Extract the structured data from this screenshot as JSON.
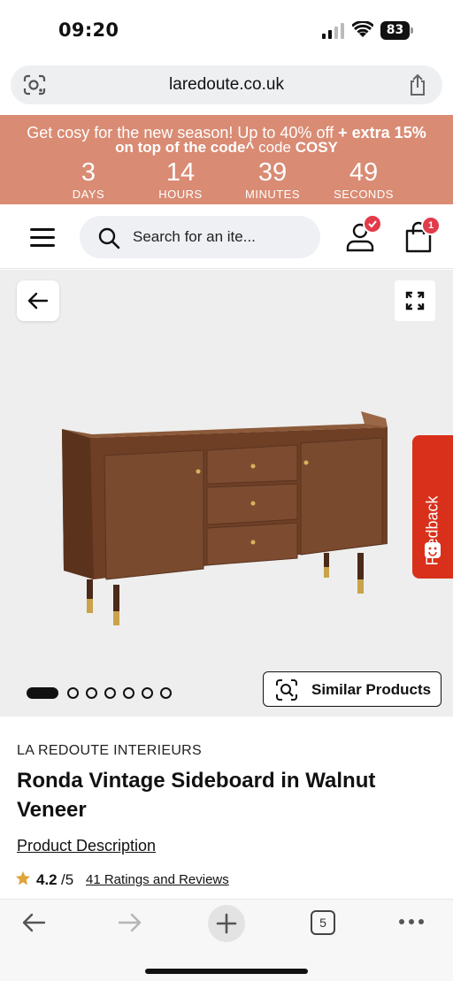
{
  "status_bar": {
    "time": "09:20",
    "battery": "83"
  },
  "browser": {
    "url": "laredoute.co.uk"
  },
  "promo": {
    "line1_start": "Get cosy for the new season! Up to 40% off ",
    "line1_bold": "+ extra 15%",
    "line2_bold": "on top of the code^",
    "line2_mid": " code ",
    "line2_code": "COSY",
    "countdown": [
      {
        "value": "3",
        "label": "DAYS"
      },
      {
        "value": "14",
        "label": "HOURS"
      },
      {
        "value": "39",
        "label": "MINUTES"
      },
      {
        "value": "49",
        "label": "SECONDS"
      }
    ]
  },
  "header": {
    "search_placeholder": "Search for an ite...",
    "cart_count": "1"
  },
  "gallery": {
    "feedback_label": "Feedback",
    "similar_label": "Similar Products",
    "image_count": 7,
    "active_index": 0
  },
  "product": {
    "brand": "LA REDOUTE INTERIEURS",
    "title": "Ronda Vintage Sideboard in Walnut Veneer",
    "description_link": "Product Description",
    "rating": "4.2",
    "rating_max": "/5",
    "reviews_link": "41 Ratings and Reviews"
  },
  "toolbar": {
    "tab_count": "5"
  },
  "colors": {
    "promo_bg": "#d98b73",
    "badge": "#e23b4a",
    "feedback": "#d9301b",
    "wood": "#7a4a2e"
  }
}
